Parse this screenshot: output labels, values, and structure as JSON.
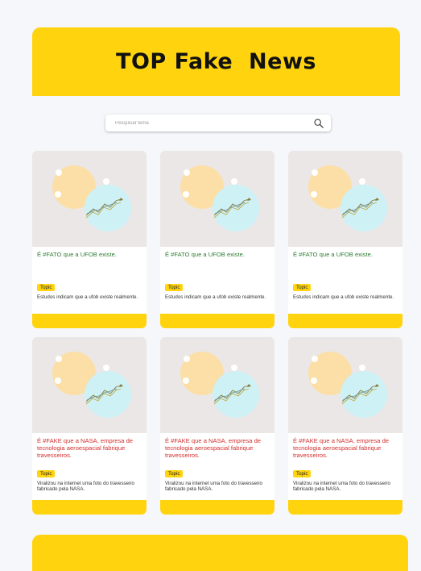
{
  "header": {
    "title": "TOP Fake  News"
  },
  "search": {
    "placeholder": "Pesquisar tema"
  },
  "cards": [
    {
      "kind": "fato",
      "title": "É #FATO que a UFOB existe.",
      "topic": "Topic",
      "description": "Estudos indicam que a ufob existe realmente."
    },
    {
      "kind": "fato",
      "title": "É #FATO que a UFOB existe.",
      "topic": "Topic",
      "description": "Estudos indicam que a ufob existe realmente."
    },
    {
      "kind": "fato",
      "title": "É #FATO que a UFOB existe.",
      "topic": "Topic",
      "description": "Estudos indicam que a ufob existe realmente."
    },
    {
      "kind": "fake",
      "title": "É #FAKE que a NASA, empresa de tecnologia aeroespacial fabrique travesseiros.",
      "topic": "Topic",
      "description": "Viralizou na internet uma foto do travesseiro fabricado pela NASA."
    },
    {
      "kind": "fake",
      "title": "É #FAKE que a NASA, empresa de tecnologia aeroespacial fabrique travesseiros.",
      "topic": "Topic",
      "description": "Viralizou na internet uma foto do travesseiro fabricado pela NASA."
    },
    {
      "kind": "fake",
      "title": "É #FAKE que a NASA, empresa de tecnologia aeroespacial fabrique travesseiros.",
      "topic": "Topic",
      "description": "Viralizou na internet uma foto do travesseiro fabricado pela NASA."
    }
  ],
  "colors": {
    "accent": "#ffd40f",
    "fato": "#2e7d32",
    "fake": "#d32f2f",
    "thumb_bg": "#ebe7e6"
  },
  "icons": {
    "search": "search-icon",
    "thumbnail": "chart-illustration-icon"
  }
}
